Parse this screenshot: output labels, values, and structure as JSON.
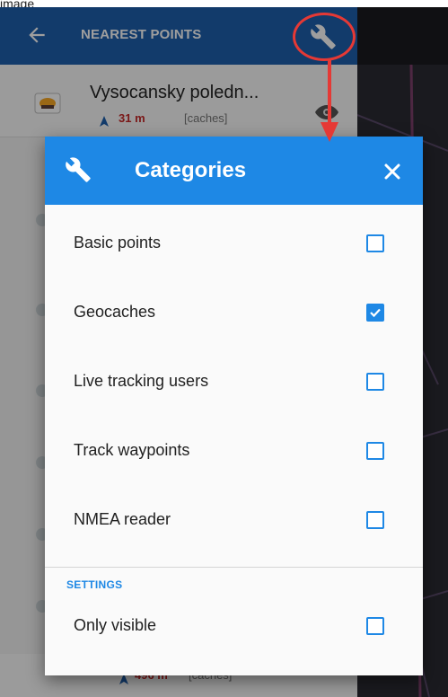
{
  "page_label": "image",
  "appbar": {
    "title": "NEAREST POINTS",
    "back_icon": "arrow-left-icon",
    "tools_icon": "wrench-icon"
  },
  "list": {
    "items": [
      {
        "name": "Vysocansky poledn...",
        "distance": "31 m",
        "tag": "[caches]"
      },
      {
        "distance": "496 m",
        "tag": "[caches]"
      }
    ]
  },
  "dialog": {
    "title": "Categories",
    "header_icon": "wrench-icon",
    "close_icon": "close-icon",
    "categories": [
      {
        "label": "Basic points",
        "checked": false
      },
      {
        "label": "Geocaches",
        "checked": true
      },
      {
        "label": "Live tracking users",
        "checked": false
      },
      {
        "label": "Track waypoints",
        "checked": false
      },
      {
        "label": "NMEA reader",
        "checked": false
      }
    ],
    "settings_section": {
      "label": "SETTINGS",
      "items": [
        {
          "label": "Only visible",
          "checked": false
        }
      ]
    }
  },
  "colors": {
    "appbar": "#1e5fad",
    "dialog_header": "#1e88e5",
    "checkbox": "#1e88e5",
    "distance": "#c62828",
    "annotation": "#e53935"
  }
}
